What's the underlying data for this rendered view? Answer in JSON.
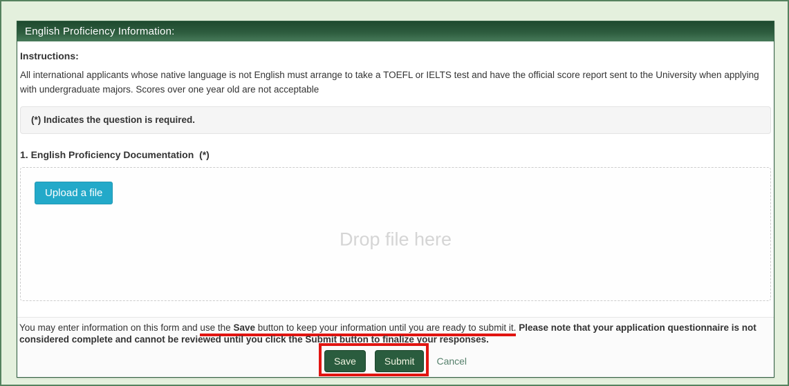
{
  "window": {
    "title": "English Proficiency Information:"
  },
  "instructions": {
    "heading": "Instructions:",
    "body": "All international applicants whose native language is not English must arrange to take a TOEFL or IELTS test and have the official score report sent to the University when applying with undergraduate majors. Scores over one year old are not acceptable"
  },
  "required_notice": {
    "text": "(*) Indicates the question is required."
  },
  "question": {
    "label": "1. English Proficiency Documentation",
    "required_marker": "(*)"
  },
  "upload": {
    "button_label": "Upload a file",
    "drop_hint": "Drop file here"
  },
  "footer_note": {
    "part_plain": "You may enter information on this form and ",
    "part_underlined_1": "use the ",
    "part_underlined_bold": "Save",
    "part_underlined_2": " button to keep your information until you are ready to submit it.",
    "part_bold": " Please note that your application questionnaire is not considered complete and cannot be reviewed until you click the Submit button to finalize your responses."
  },
  "actions": {
    "save_label": "Save",
    "submit_label": "Submit",
    "cancel_label": "Cancel"
  },
  "colors": {
    "header_green": "#2d5c3e",
    "action_button_green": "#2a5c3e",
    "upload_button_teal": "#23a9c9",
    "annotation_red": "#e11511",
    "page_background": "#e4f0dd"
  }
}
